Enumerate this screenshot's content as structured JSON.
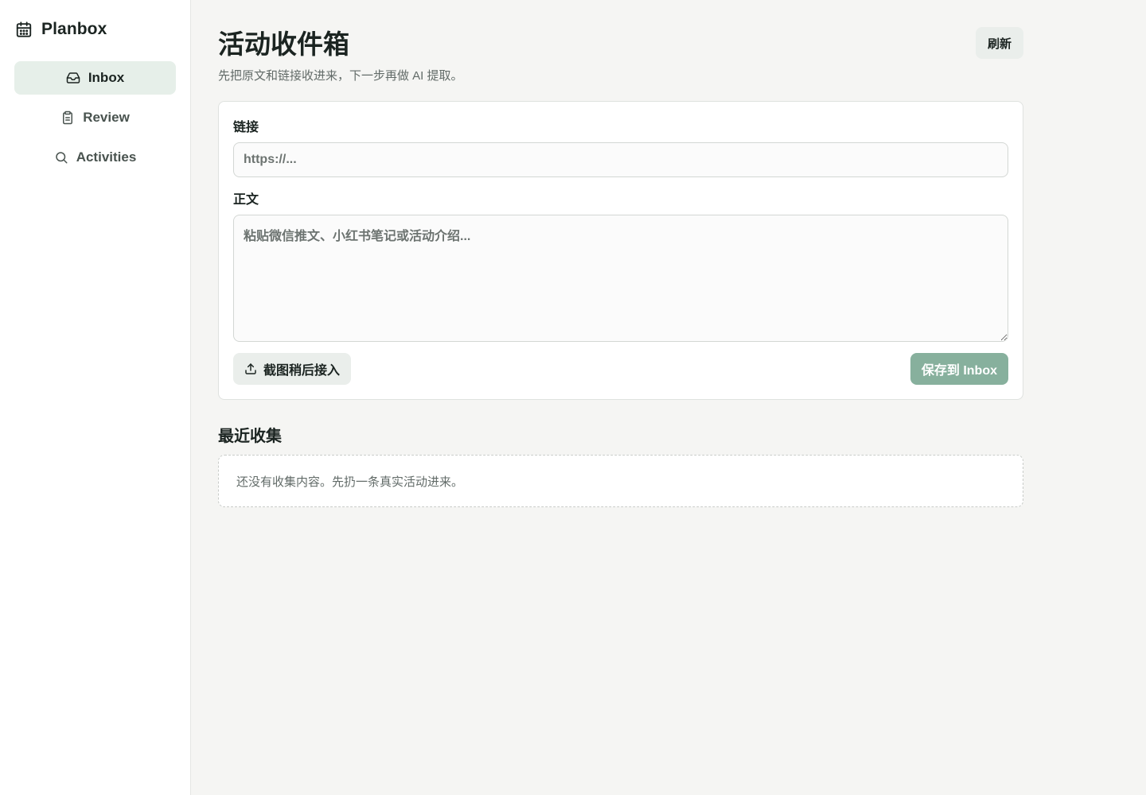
{
  "app": {
    "name": "Planbox"
  },
  "sidebar": {
    "items": [
      {
        "label": "Inbox",
        "icon": "inbox-icon",
        "active": true
      },
      {
        "label": "Review",
        "icon": "clipboard-icon",
        "active": false
      },
      {
        "label": "Activities",
        "icon": "search-icon",
        "active": false
      }
    ]
  },
  "header": {
    "title": "活动收件箱",
    "subtitle": "先把原文和链接收进来，下一步再做 AI 提取。",
    "refresh_label": "刷新"
  },
  "form": {
    "link_label": "链接",
    "link_placeholder": "https://...",
    "body_label": "正文",
    "body_placeholder": "粘贴微信推文、小红书笔记或活动介绍...",
    "upload_label": "截图稍后接入",
    "save_label": "保存到 Inbox"
  },
  "recent": {
    "title": "最近收集",
    "empty_text": "还没有收集内容。先扔一条真实活动进来。"
  },
  "colors": {
    "accent": "#87b09d",
    "active_nav_bg": "#e6efe9",
    "background": "#f5f5f3"
  }
}
